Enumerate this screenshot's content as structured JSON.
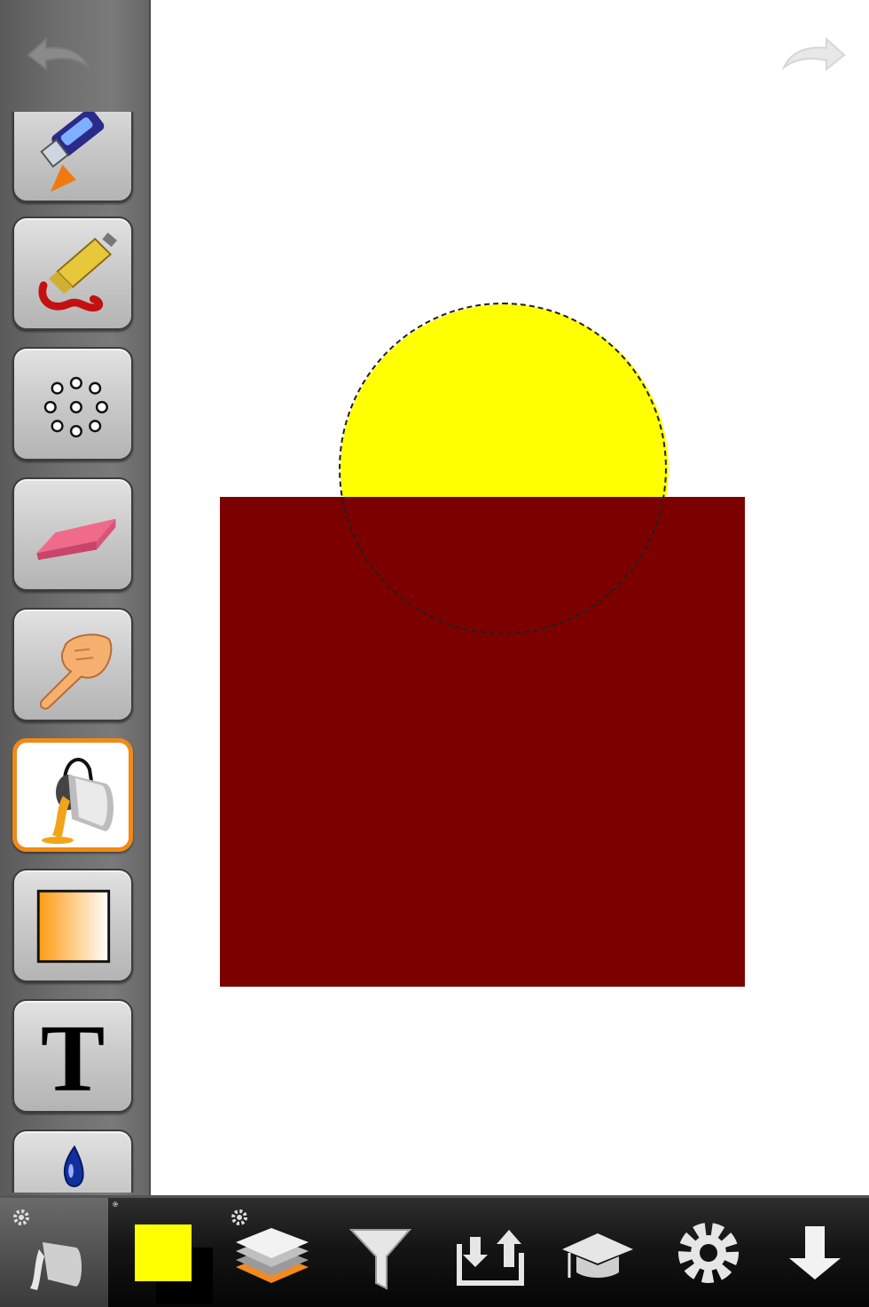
{
  "app": {
    "accent_color": "#f08a18",
    "active_tool": "paint-bucket"
  },
  "sidebar": {
    "tools": [
      {
        "name": "marker-tool",
        "icon": "marker-icon"
      },
      {
        "name": "paint-tube-tool",
        "icon": "paint-tube-icon"
      },
      {
        "name": "brush-settings-tool",
        "icon": "dots-ring-icon"
      },
      {
        "name": "eraser-tool",
        "icon": "eraser-icon"
      },
      {
        "name": "smudge-tool",
        "icon": "pointing-finger-icon"
      },
      {
        "name": "paint-bucket-tool",
        "icon": "paint-bucket-icon"
      },
      {
        "name": "gradient-tool",
        "icon": "gradient-square-icon"
      },
      {
        "name": "text-tool",
        "icon": "text-t-icon",
        "glyph": "T"
      },
      {
        "name": "dropper-tool",
        "icon": "drop-icon"
      }
    ]
  },
  "canvas": {
    "shapes": [
      {
        "type": "circle",
        "color": "#ffff00"
      },
      {
        "type": "rectangle",
        "color": "#7c0000"
      }
    ]
  },
  "bottombar": {
    "current_color": "#ffff00",
    "items": [
      {
        "name": "fill-options",
        "icon": "paint-bucket-icon"
      },
      {
        "name": "color-picker",
        "icon": "color-swatch-icon"
      },
      {
        "name": "layers",
        "icon": "layers-icon"
      },
      {
        "name": "filters",
        "icon": "funnel-icon"
      },
      {
        "name": "import-export",
        "icon": "import-export-icon"
      },
      {
        "name": "tutorials",
        "icon": "graduation-cap-icon"
      },
      {
        "name": "settings",
        "icon": "gear-icon"
      },
      {
        "name": "save",
        "icon": "arrow-down-icon"
      }
    ]
  }
}
